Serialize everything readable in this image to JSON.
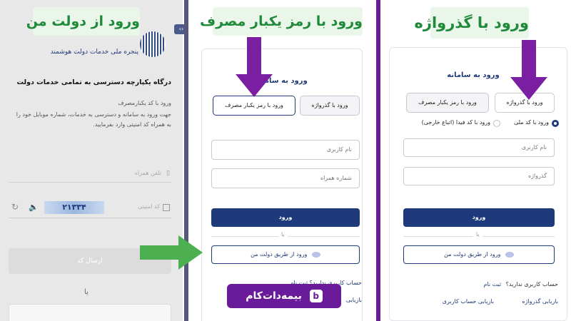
{
  "panel1": {
    "callout": "ورود از دولت من",
    "logo_title": "پنجره ملی خدمات دولت هوشمند",
    "heading": "درگاه یکپارچه دسترسی به تمامی خدمات دولت",
    "sub_heading": "ورود با کد یکبارمصرف",
    "desc_line1": "جهت ورود به سامانه و دسترسی به خدمات، شماره موبایل خود را",
    "desc_line2": "به همراه کد امنیتی وارد بفرمایید.",
    "phone_placeholder": "تلفن همراه",
    "captcha_label": "کد امنیتی",
    "captcha_text": "۲۱۳۳۴",
    "send_code": "ارسال کد",
    "or_label": "یا"
  },
  "panel2": {
    "callout": "ورود با رمز یکبار مصرف",
    "title": "ورود به سامانه",
    "tab_otp": "ورود با رمز یکبار مصرف",
    "tab_password": "ورود با گذرواژه",
    "username_placeholder": "نام کاربری",
    "mobile_placeholder": "شماره همراه",
    "login_button": "ورود",
    "or_label": "یا",
    "dolat_login": "ورود از طریق دولت من",
    "signup_partial": "حساب کاربری ندارید؟ ثبت نام",
    "recover_partial": "بازیابی"
  },
  "panel3": {
    "callout": "ورود با گذرواژه",
    "title": "ورود به سامانه",
    "tab_password": "ورود با گذرواژه",
    "tab_otp": "ورود با رمز یکبار مصرف",
    "radio_national": "ورود با کد ملی",
    "radio_fida": "ورود با کد فیدا (اتباع خارجی)",
    "username_placeholder": "نام کاربری",
    "password_placeholder": "گذرواژه",
    "login_button": "ورود",
    "or_label": "یا",
    "dolat_login": "ورود از طریق دولت من",
    "no_account": "حساب کاربری ندارید؟",
    "signup": "ثبت نام",
    "recover_password": "بازیابی گذرواژه",
    "recover_account": "بازیابی حساب کاربری"
  },
  "brand": {
    "label": "بیمه‌دات‌کام",
    "color": "#6a1b9a"
  },
  "colors": {
    "accent_purple": "#6a1b9a",
    "callout_green": "#1f8a3a",
    "navy": "#1f3a7a"
  }
}
